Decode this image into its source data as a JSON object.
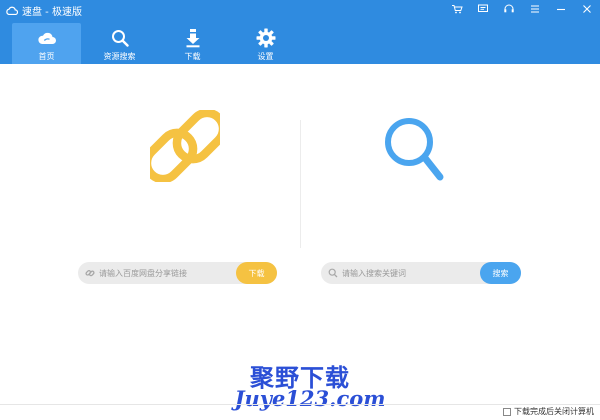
{
  "app": {
    "title": "速盘 - 极速版"
  },
  "window_controls": [
    "cart-icon",
    "message-icon",
    "headset-icon",
    "menu-icon",
    "minimize-icon",
    "close-icon"
  ],
  "tabs": [
    {
      "label": "首页",
      "icon": "cloud-icon",
      "active": true
    },
    {
      "label": "资源搜索",
      "icon": "search-icon",
      "active": false
    },
    {
      "label": "下载",
      "icon": "download-icon",
      "active": false
    },
    {
      "label": "设置",
      "icon": "gear-icon",
      "active": false
    }
  ],
  "share_link": {
    "placeholder": "请输入百度网盘分享链接",
    "button": "下载",
    "button_color": "#f5c242"
  },
  "resource_search": {
    "placeholder": "请输入搜索关键词",
    "button": "搜索",
    "button_color": "#4aa5ef"
  },
  "footer": {
    "shutdown_label": "下载完成后关闭计算机",
    "shutdown_checked": false
  },
  "watermark": {
    "line1": "聚野下载",
    "line2": "Juye123.com"
  },
  "colors": {
    "titlebar": "#2f8be0",
    "active_tab": "#4fa3ef",
    "link_illustration": "#f5c242",
    "search_illustration": "#4aa5ef"
  }
}
